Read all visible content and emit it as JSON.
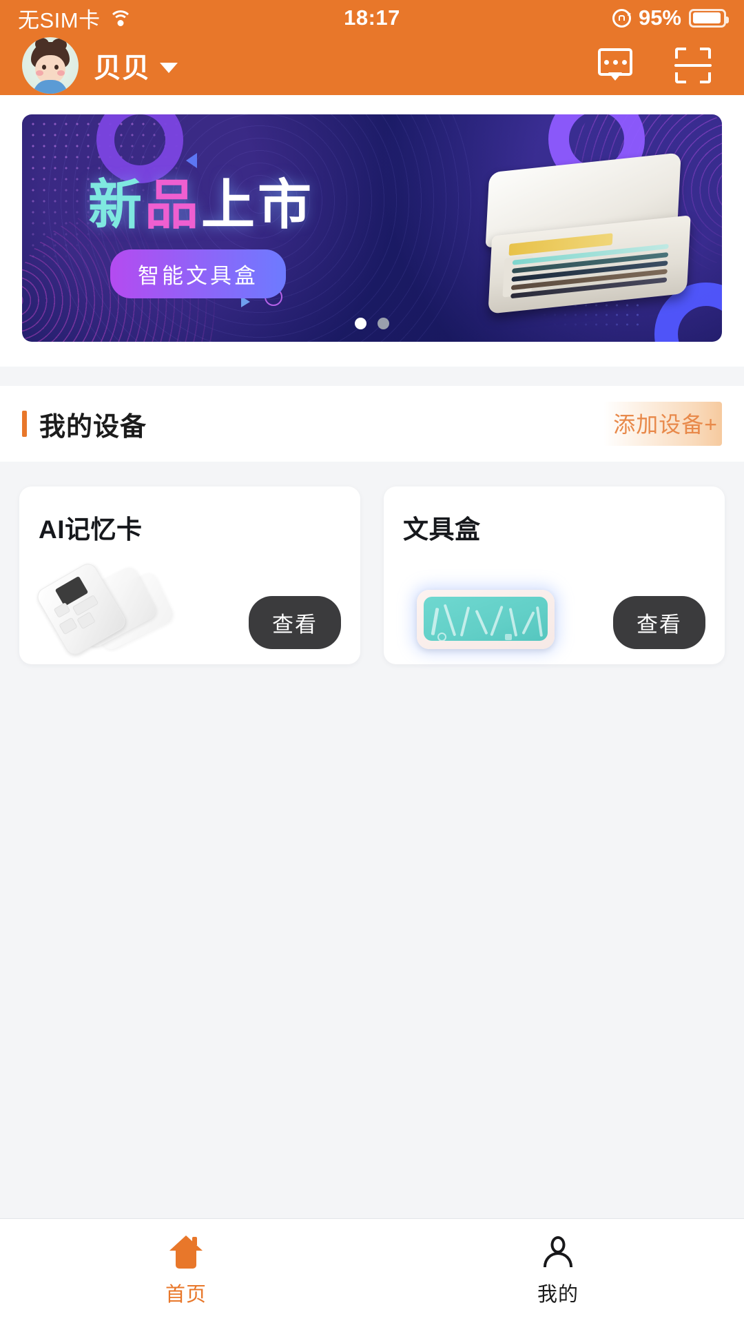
{
  "status_bar": {
    "carrier": "无SIM卡",
    "wifi_icon": "wifi-icon",
    "time": "18:17",
    "rotation_lock_icon": "rotation-lock-icon",
    "battery_percent": "95%",
    "battery_icon": "battery-icon"
  },
  "header": {
    "avatar_icon": "avatar",
    "user_name": "贝贝",
    "caret_icon": "chevron-down-icon",
    "message_icon": "message-bubble-icon",
    "scan_icon": "scan-qr-icon",
    "background_color": "#e8772a"
  },
  "banner": {
    "title_part1": "新",
    "title_part2": "品",
    "title_part3": "上市",
    "subtitle": "智能文具盒",
    "product_image": "smart-pencil-case-photo",
    "slide_count": 2,
    "active_slide": 1
  },
  "devices_section": {
    "title": "我的设备",
    "add_label": "添加设备+",
    "accent_color": "#e8772a",
    "cards": [
      {
        "title": "AI记忆卡",
        "image": "ai-memory-card-device",
        "button_label": "查看"
      },
      {
        "title": "文具盒",
        "image": "pencil-case-device",
        "button_label": "查看"
      }
    ]
  },
  "tab_bar": {
    "tabs": [
      {
        "label": "首页",
        "icon": "home-icon",
        "active": true
      },
      {
        "label": "我的",
        "icon": "user-icon",
        "active": false
      }
    ],
    "active_color": "#e8772a"
  }
}
